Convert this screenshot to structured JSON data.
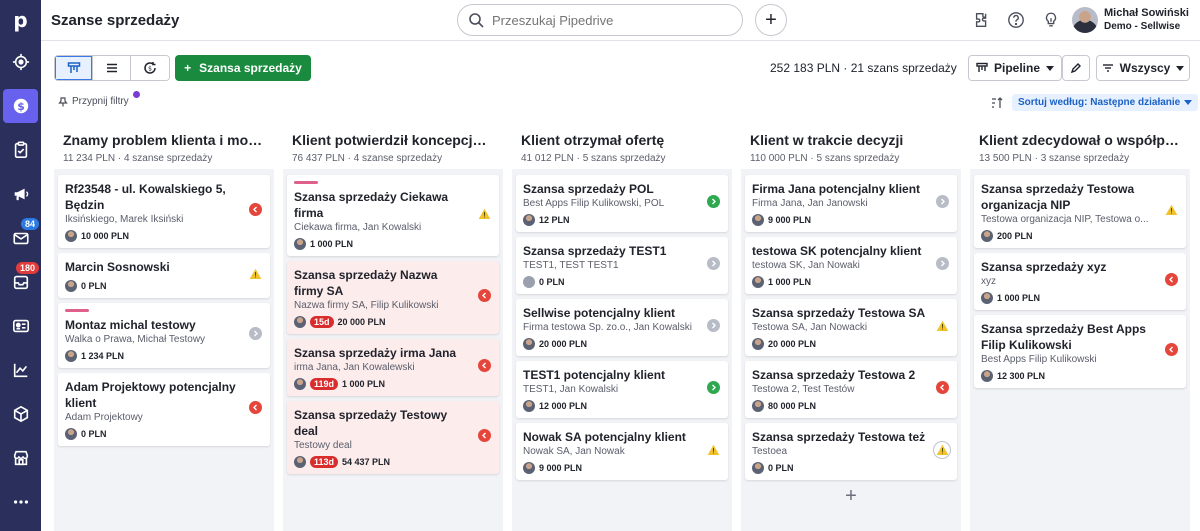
{
  "app": {
    "logo": "p",
    "page_title": "Szanse sprzedaży"
  },
  "search": {
    "placeholder": "Przeszukaj Pipedrive"
  },
  "user": {
    "name": "Michał Sowiński",
    "company": "Demo - Sellwise"
  },
  "sidebar": {
    "items": [
      {
        "icon": "target-icon"
      },
      {
        "icon": "dollar-icon",
        "active": true
      },
      {
        "icon": "clipboard-icon"
      },
      {
        "icon": "megaphone-icon"
      },
      {
        "icon": "mail-icon",
        "badge": "84"
      },
      {
        "icon": "inbox-icon",
        "badge": "180"
      },
      {
        "icon": "contacts-icon"
      },
      {
        "icon": "chart-icon"
      },
      {
        "icon": "box-icon"
      },
      {
        "icon": "store-icon"
      },
      {
        "icon": "more-icon"
      }
    ]
  },
  "toolbar": {
    "new_deal": "Szansa sprzedaży",
    "total_value": "252 183 PLN",
    "deal_count": "21 szans sprzedaży",
    "pipeline_label": "Pipeline",
    "filter_label": "Wszyscy",
    "pin_filters": "Przypnij filtry",
    "sort_label": "Sortuj według: Następne działanie"
  },
  "columns": [
    {
      "title": "Znamy problem klienta i możem...",
      "summary": "11 234 PLN · 4 szanse sprzedaży",
      "cards": [
        {
          "title": "Rf23548 - ul. Kowalskiego 5, Będzin",
          "org": "Iksińskiego, Marek Iksiński",
          "value": "10 000 PLN",
          "status": "red",
          "bar": false,
          "rotten": false,
          "days": ""
        },
        {
          "title": "Marcin Sosnowski",
          "org": "",
          "value": "0 PLN",
          "status": "warn",
          "bar": false,
          "rotten": false,
          "days": ""
        },
        {
          "title": "Montaz michal testowy",
          "org": "Walka o Prawa, Michał Testowy",
          "value": "1 234 PLN",
          "status": "gray",
          "bar": true,
          "rotten": false,
          "days": ""
        },
        {
          "title": "Adam Projektowy potencjalny klient",
          "org": "Adam Projektowy",
          "value": "0 PLN",
          "status": "red",
          "bar": false,
          "rotten": false,
          "days": ""
        }
      ]
    },
    {
      "title": "Klient potwierdził koncepcję ro...",
      "summary": "76 437 PLN · 4 szanse sprzedaży",
      "cards": [
        {
          "title": "Szansa sprzedaży Ciekawa firma",
          "org": "Ciekawa firma, Jan Kowalski",
          "value": "1 000 PLN",
          "status": "warn",
          "bar": true,
          "rotten": false,
          "days": ""
        },
        {
          "title": "Szansa sprzedaży Nazwa firmy SA",
          "org": "Nazwa firmy SA, Filip Kulikowski",
          "value": "20 000 PLN",
          "status": "red",
          "bar": false,
          "rotten": true,
          "days": "15d"
        },
        {
          "title": "Szansa sprzedaży irma Jana",
          "org": "irma Jana, Jan Kowalewski",
          "value": "1 000 PLN",
          "status": "red",
          "bar": false,
          "rotten": true,
          "days": "119d"
        },
        {
          "title": "Szansa sprzedaży Testowy deal",
          "org": "Testowy deal",
          "value": "54 437 PLN",
          "status": "red",
          "bar": false,
          "rotten": true,
          "days": "113d"
        }
      ]
    },
    {
      "title": "Klient otrzymał ofertę",
      "summary": "41 012 PLN · 5 szans sprzedaży",
      "cards": [
        {
          "title": "Szansa sprzedaży POL",
          "org": "Best Apps Filip Kulikowski, POL",
          "value": "12 PLN",
          "status": "green",
          "bar": false,
          "rotten": false,
          "days": ""
        },
        {
          "title": "Szansa sprzedaży TEST1",
          "org": "TEST1, TEST TEST1",
          "value": "0 PLN",
          "status": "gray",
          "bar": false,
          "rotten": false,
          "days": ""
        },
        {
          "title": "Sellwise potencjalny klient",
          "org": "Firma testowa Sp. zo.o., Jan Kowalski",
          "value": "20 000 PLN",
          "status": "gray",
          "bar": false,
          "rotten": false,
          "days": ""
        },
        {
          "title": "TEST1 potencjalny klient",
          "org": "TEST1, Jan Kowalski",
          "value": "12 000 PLN",
          "status": "green",
          "bar": false,
          "rotten": false,
          "days": ""
        },
        {
          "title": "Nowak SA potencjalny klient",
          "org": "Nowak SA, Jan Nowak",
          "value": "9 000 PLN",
          "status": "warn",
          "bar": false,
          "rotten": false,
          "days": ""
        }
      ]
    },
    {
      "title": "Klient w trakcie decyzji",
      "summary": "110 000 PLN · 5 szans sprzedaży",
      "cards": [
        {
          "title": "Firma Jana potencjalny klient",
          "org": "Firma Jana, Jan Janowski",
          "value": "9 000 PLN",
          "status": "gray",
          "bar": false,
          "rotten": false,
          "days": ""
        },
        {
          "title": "testowa SK potencjalny klient",
          "org": "testowa SK, Jan Nowaki",
          "value": "1 000 PLN",
          "status": "gray",
          "bar": false,
          "rotten": false,
          "days": ""
        },
        {
          "title": "Szansa sprzedaży Testowa SA",
          "org": "Testowa SA, Jan Nowacki",
          "value": "20 000 PLN",
          "status": "warn",
          "bar": false,
          "rotten": false,
          "days": ""
        },
        {
          "title": "Szansa sprzedaży Testowa 2",
          "org": "Testowa 2, Test Testów",
          "value": "80 000 PLN",
          "status": "red",
          "bar": false,
          "rotten": false,
          "days": ""
        },
        {
          "title": "Szansa sprzedaży Testowa też",
          "org": "Testoea",
          "value": "0 PLN",
          "status": "warn-circle",
          "bar": false,
          "rotten": false,
          "days": ""
        }
      ],
      "add": "+"
    },
    {
      "title": "Klient zdecydował o współpracy",
      "summary": "13 500 PLN · 3 szanse sprzedaży",
      "cards": [
        {
          "title": "Szansa sprzedaży Testowa organizacja NIP",
          "org": "Testowa organizacja NIP, Testowa o...",
          "value": "200 PLN",
          "status": "warn",
          "bar": false,
          "rotten": false,
          "days": ""
        },
        {
          "title": "Szansa sprzedaży xyz",
          "org": "xyz",
          "value": "1 000 PLN",
          "status": "red",
          "bar": false,
          "rotten": false,
          "days": ""
        },
        {
          "title": "Szansa sprzedaży Best Apps Filip Kulikowski",
          "org": "Best Apps Filip Kulikowski",
          "value": "12 300 PLN",
          "status": "red",
          "bar": false,
          "rotten": false,
          "days": ""
        }
      ]
    }
  ]
}
